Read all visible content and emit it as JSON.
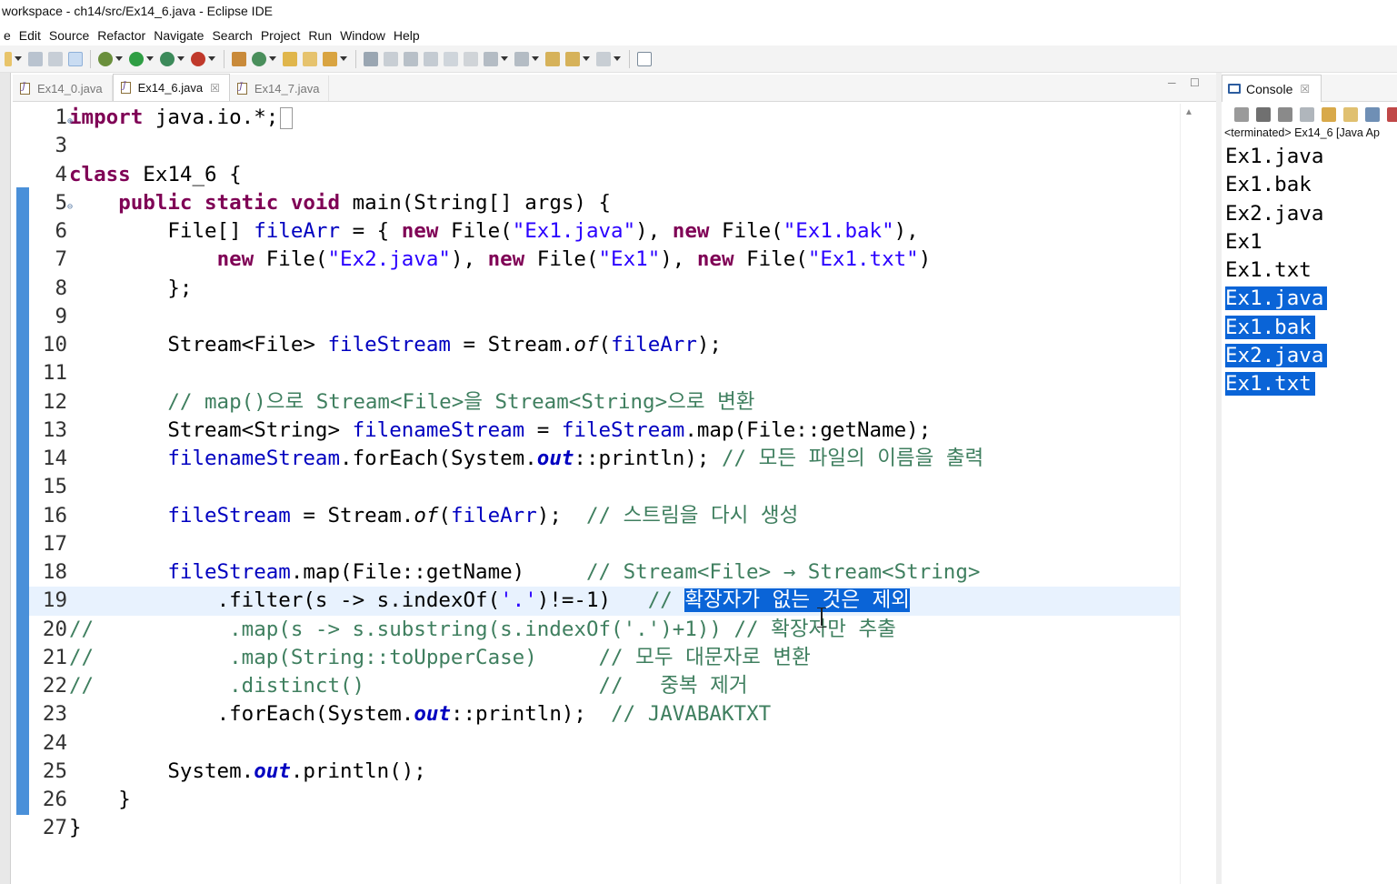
{
  "window": {
    "title": "workspace - ch14/src/Ex14_6.java - Eclipse IDE"
  },
  "menu": [
    "e",
    "Edit",
    "Source",
    "Refactor",
    "Navigate",
    "Search",
    "Project",
    "Run",
    "Window",
    "Help"
  ],
  "editor_tabs": [
    {
      "label": "Ex14_0.java"
    },
    {
      "label": "Ex14_6.java",
      "close": "☒"
    },
    {
      "label": "Ex14_7.java"
    }
  ],
  "code": {
    "l1": {
      "num": "1",
      "kw": "import",
      "rest": " java.io.*;"
    },
    "l3": {
      "num": "3"
    },
    "l4": {
      "num": "4",
      "kw": "class",
      "rest": " Ex14_6 {"
    },
    "l5": {
      "num": "5",
      "kw": "public static void",
      "rest": " main(String[] args) {"
    },
    "l6": {
      "num": "6",
      "a": "File[] ",
      "var": "fileArr",
      "b": " = { ",
      "kw1": "new",
      "c": " File(",
      "s1": "\"Ex1.java\"",
      "d": "), ",
      "kw2": "new",
      "e": " File(",
      "s2": "\"Ex1.bak\"",
      "f": "),"
    },
    "l7": {
      "num": "7",
      "kw1": "new",
      "a": " File(",
      "s1": "\"Ex2.java\"",
      "b": "), ",
      "kw2": "new",
      "c": " File(",
      "s2": "\"Ex1\"",
      "d": "), ",
      "kw3": "new",
      "e": " File(",
      "s3": "\"Ex1.txt\"",
      "f": ")"
    },
    "l8": {
      "num": "8",
      "rest": "};"
    },
    "l9": {
      "num": "9"
    },
    "l10": {
      "num": "10",
      "a": "Stream<File> ",
      "var": "fileStream",
      "b": " = Stream.",
      "m": "of",
      "c": "(",
      "var2": "fileArr",
      "d": ");"
    },
    "l11": {
      "num": "11"
    },
    "l12": {
      "num": "12",
      "comment": "// map()으로 Stream<File>을 Stream<String>으로 변환"
    },
    "l13": {
      "num": "13",
      "a": "Stream<String> ",
      "var": "filenameStream",
      "b": " = ",
      "var2": "fileStream",
      "c": ".map(File::getName);"
    },
    "l14": {
      "num": "14",
      "var": "filenameStream",
      "a": ".forEach(System.",
      "st": "out",
      "b": "::println); ",
      "comment": "// 모든 파일의 이름을 출력"
    },
    "l15": {
      "num": "15"
    },
    "l16": {
      "num": "16",
      "var": "fileStream",
      "a": " = Stream.",
      "m": "of",
      "b": "(",
      "var2": "fileArr",
      "c": ");  ",
      "comment": "// 스트림을 다시 생성"
    },
    "l17": {
      "num": "17"
    },
    "l18": {
      "num": "18",
      "var": "fileStream",
      "a": ".map(File::getName)     ",
      "comment": "// Stream<File> → Stream<String>"
    },
    "l19": {
      "num": "19",
      "a": ".filter(s -> s.indexOf(",
      "s1": "'.'",
      "b": ")!=-1)   ",
      "comment": "// ",
      "selected": "확장자가 없는 것은 제외"
    },
    "l20": {
      "num": "20",
      "comment": "//           .map(s -> s.substring(s.indexOf('.')+1)) // 확장자만 추출"
    },
    "l21": {
      "num": "21",
      "comment": "//           .map(String::toUpperCase)     // 모두 대문자로 변환"
    },
    "l22": {
      "num": "22",
      "comment": "//           .distinct()                   //   중복 제거"
    },
    "l23": {
      "num": "23",
      "a": ".forEach(System.",
      "st": "out",
      "b": "::println);  ",
      "comment": "// JAVABAKTXT"
    },
    "l24": {
      "num": "24"
    },
    "l25": {
      "num": "25",
      "a": "System.",
      "st": "out",
      "b": ".println();"
    },
    "l26": {
      "num": "26",
      "rest": "}"
    },
    "l27": {
      "num": "27",
      "rest": "}"
    }
  },
  "console": {
    "tab_label": "Console",
    "close": "☒",
    "status": "<terminated> Ex14_6 [Java Ap",
    "output": [
      "Ex1.java",
      "Ex1.bak",
      "Ex2.java",
      "Ex1",
      "Ex1.txt"
    ],
    "selected_output": [
      "Ex1.java",
      "Ex1.bak",
      "Ex2.java",
      "Ex1.txt"
    ]
  },
  "colors": {
    "keyword": "#7f0055",
    "string": "#2a00ff",
    "comment": "#3f7f5f",
    "field": "#0000c0",
    "selection": "#0a64d7",
    "current_line": "#e8f2fe"
  }
}
